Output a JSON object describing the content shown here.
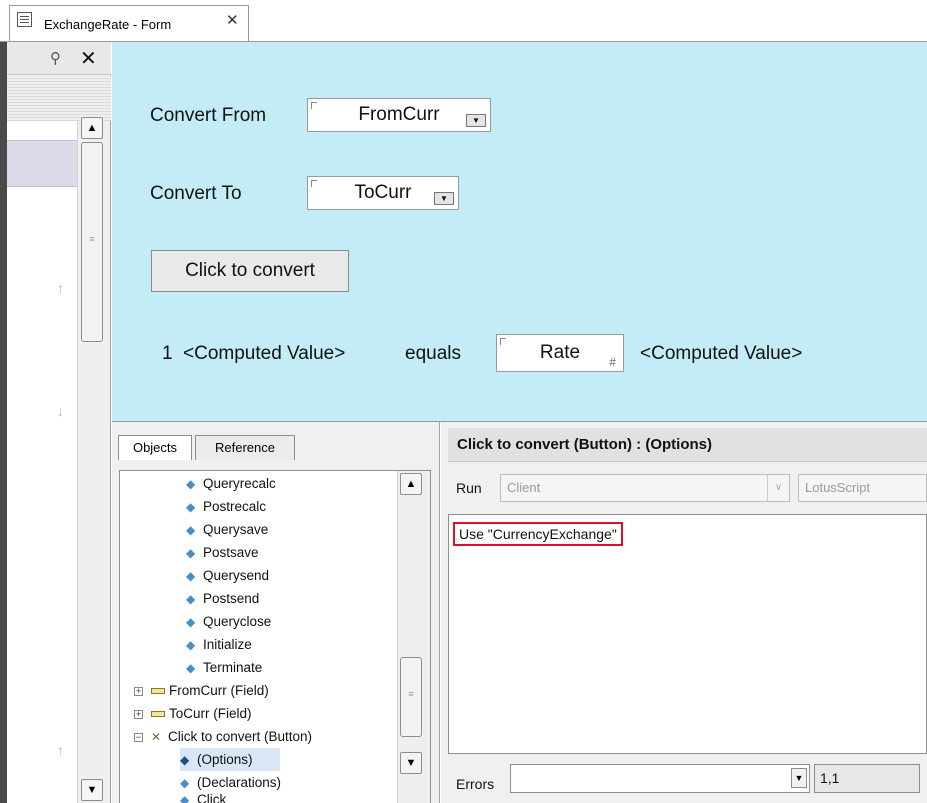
{
  "tab": {
    "title": "ExchangeRate - Form",
    "close_glyph": "✕",
    "icon": "form-icon"
  },
  "left_panel": {
    "pin_glyph": "⚲",
    "close_glyph": "✕"
  },
  "form": {
    "convert_from_label": "Convert From",
    "from_field": "FromCurr",
    "convert_to_label": "Convert To",
    "to_field": "ToCurr",
    "button_label": "Click to convert",
    "number_one": "1",
    "computed_value_1": "<Computed Value>",
    "equals_label": "equals",
    "rate_field": "Rate",
    "rate_type_glyph": "#",
    "computed_value_2": "<Computed Value>"
  },
  "objects_panel": {
    "tabs": [
      {
        "label": "Objects"
      },
      {
        "label": "Reference"
      }
    ],
    "events": [
      {
        "label": "Queryrecalc"
      },
      {
        "label": "Postrecalc"
      },
      {
        "label": "Querysave"
      },
      {
        "label": "Postsave"
      },
      {
        "label": "Querysend"
      },
      {
        "label": "Postsend"
      },
      {
        "label": "Queryclose"
      },
      {
        "label": "Initialize"
      },
      {
        "label": "Terminate"
      }
    ],
    "fields": [
      {
        "label": "FromCurr (Field)",
        "toggle": "+"
      },
      {
        "label": "ToCurr (Field)",
        "toggle": "+"
      }
    ],
    "button_node": {
      "label": "Click to convert (Button)",
      "toggle": "−"
    },
    "button_children": [
      {
        "label": "(Options)"
      },
      {
        "label": "(Declarations)"
      },
      {
        "label": "Click"
      }
    ]
  },
  "code_panel": {
    "title": "Click to convert (Button) : (Options)",
    "run_label": "Run",
    "run_target": "Client",
    "language": "LotusScript",
    "code_text": "Use \"CurrencyExchange\"",
    "errors_label": "Errors",
    "errors_value": "",
    "position": "1,1"
  },
  "colors": {
    "form_background": "#c3ecf7",
    "highlight_border": "#d8102a",
    "event_icon": "#4a8ec8"
  }
}
